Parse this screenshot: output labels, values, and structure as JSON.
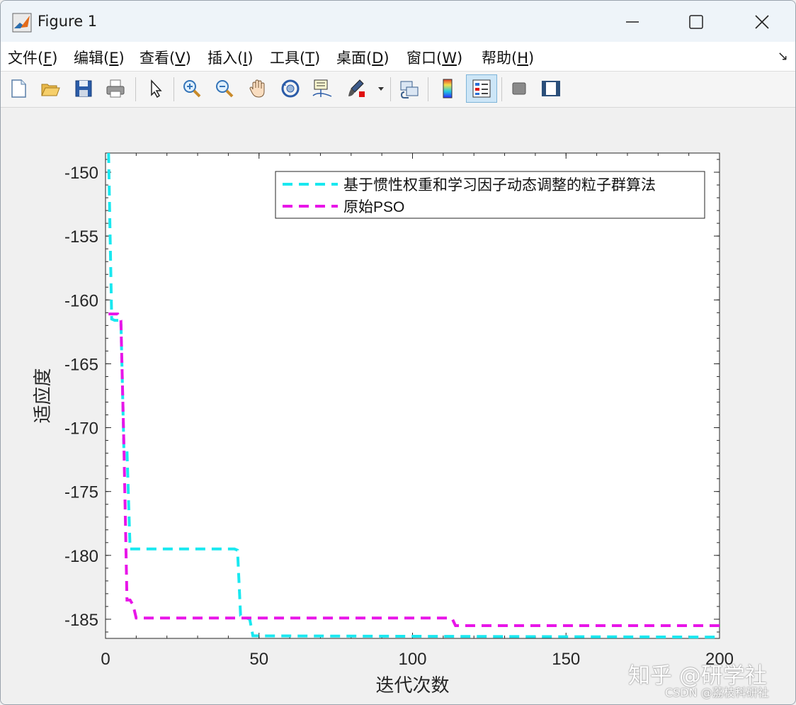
{
  "window": {
    "title": "Figure 1"
  },
  "menu": [
    {
      "label": "文件(",
      "key": "F",
      "tail": ")"
    },
    {
      "label": "编辑(",
      "key": "E",
      "tail": ")"
    },
    {
      "label": "查看(",
      "key": "V",
      "tail": ")"
    },
    {
      "label": "插入(",
      "key": "I",
      "tail": ")"
    },
    {
      "label": "工具(",
      "key": "T",
      "tail": ")"
    },
    {
      "label": "桌面(",
      "key": "D",
      "tail": ")"
    },
    {
      "label": "窗口(",
      "key": "W",
      "tail": ")"
    },
    {
      "label": "帮助(",
      "key": "H",
      "tail": ")"
    }
  ],
  "toolbar": {
    "icons": [
      "new-figure-icon",
      "open-file-icon",
      "save-icon",
      "print-icon",
      "select-arrow-icon",
      "zoom-in-icon",
      "zoom-out-icon",
      "pan-hand-icon",
      "rotate-3d-icon",
      "data-cursor-icon",
      "brush-icon",
      "link-plot-icon",
      "colorbar-icon",
      "legend-icon",
      "hide-plot-tools-icon",
      "show-plot-tools-icon"
    ]
  },
  "chart_data": {
    "type": "line",
    "xlabel": "迭代次数",
    "ylabel": "适应度",
    "xlim": [
      0,
      200
    ],
    "ylim": [
      -186.5,
      -148.5
    ],
    "xticks": [
      "0",
      "50",
      "100",
      "150",
      "200"
    ],
    "yticks": [
      "-150",
      "-155",
      "-160",
      "-165",
      "-170",
      "-175",
      "-180",
      "-185"
    ],
    "legend_position": "top-right",
    "series": [
      {
        "name": "基于惯性权重和学习因子动态调整的粒子群算法",
        "color": "#19e8f0",
        "style": "dashed",
        "x": [
          1,
          1,
          2,
          3,
          4,
          5,
          6,
          7,
          8,
          9,
          42,
          43,
          44,
          47,
          48,
          200
        ],
        "y": [
          -148.5,
          -148.5,
          -161.5,
          -161.6,
          -161.6,
          -161.6,
          -171.8,
          -171.8,
          -179.5,
          -179.5,
          -179.5,
          -179.6,
          -184.7,
          -185.0,
          -186.3,
          -186.4
        ]
      },
      {
        "name": "原始PSO",
        "color": "#e815e8",
        "style": "dashed",
        "x": [
          1,
          4,
          5,
          6,
          7,
          8,
          9,
          10,
          112,
          113,
          114,
          200
        ],
        "y": [
          -161.1,
          -161.1,
          -161.6,
          -171.5,
          -183.5,
          -183.5,
          -183.9,
          -184.9,
          -184.9,
          -185.0,
          -185.5,
          -185.5
        ]
      }
    ]
  },
  "watermark": {
    "line1": "知乎 @研学社",
    "line2": "CSDN @荔枝科研社"
  },
  "colors": {
    "accent": "#1a7fd4",
    "cyan": "#19e8f0",
    "magenta": "#e815e8"
  }
}
